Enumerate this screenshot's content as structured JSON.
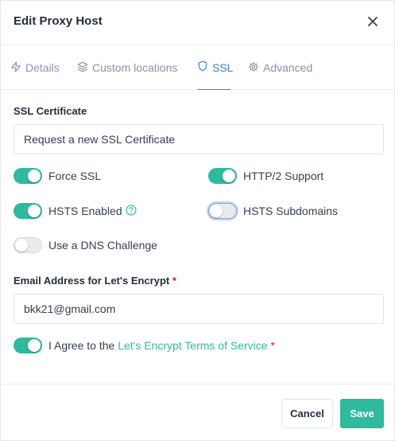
{
  "header": {
    "title": "Edit Proxy Host"
  },
  "tabs": [
    {
      "label": "Details",
      "icon": "zap-icon",
      "active": false
    },
    {
      "label": "Custom locations",
      "icon": "layers-icon",
      "active": false
    },
    {
      "label": "SSL",
      "icon": "shield-icon",
      "active": true
    },
    {
      "label": "Advanced",
      "icon": "gear-icon",
      "active": false
    }
  ],
  "ssl": {
    "certificate_label": "SSL Certificate",
    "certificate_value": "Request a new SSL Certificate",
    "toggles": {
      "force_ssl": {
        "label": "Force SSL",
        "on": true
      },
      "http2": {
        "label": "HTTP/2 Support",
        "on": true
      },
      "hsts": {
        "label": "HSTS Enabled",
        "on": true
      },
      "hsts_sub": {
        "label": "HSTS Subdomains",
        "on": false
      },
      "dns": {
        "label": "Use a DNS Challenge",
        "on": false
      }
    },
    "email_label": "Email Address for Let's Encrypt",
    "required_mark": "*",
    "email_value": "bkk21@gmail.com",
    "agree": {
      "prefix": "I Agree to the",
      "link": "Let's Encrypt Terms of Service",
      "on": true
    }
  },
  "footer": {
    "cancel_label": "Cancel",
    "save_label": "Save"
  },
  "colors": {
    "accent": "#2fb99e",
    "tab_active": "#3b82c4",
    "required": "#cd201f"
  }
}
